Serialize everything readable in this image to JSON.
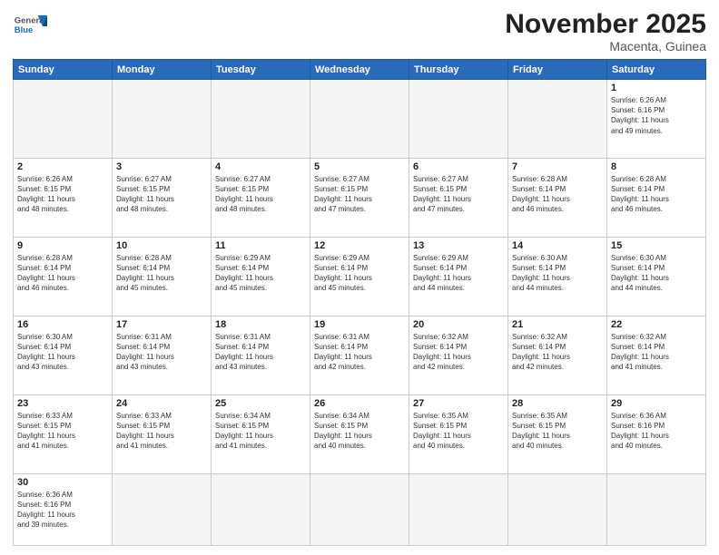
{
  "header": {
    "logo_general": "General",
    "logo_blue": "Blue",
    "main_title": "November 2025",
    "subtitle": "Macenta, Guinea"
  },
  "days_of_week": [
    "Sunday",
    "Monday",
    "Tuesday",
    "Wednesday",
    "Thursday",
    "Friday",
    "Saturday"
  ],
  "weeks": [
    [
      {
        "day": "",
        "info": ""
      },
      {
        "day": "",
        "info": ""
      },
      {
        "day": "",
        "info": ""
      },
      {
        "day": "",
        "info": ""
      },
      {
        "day": "",
        "info": ""
      },
      {
        "day": "",
        "info": ""
      },
      {
        "day": "1",
        "info": "Sunrise: 6:26 AM\nSunset: 6:16 PM\nDaylight: 11 hours\nand 49 minutes."
      }
    ],
    [
      {
        "day": "2",
        "info": "Sunrise: 6:26 AM\nSunset: 6:15 PM\nDaylight: 11 hours\nand 48 minutes."
      },
      {
        "day": "3",
        "info": "Sunrise: 6:27 AM\nSunset: 6:15 PM\nDaylight: 11 hours\nand 48 minutes."
      },
      {
        "day": "4",
        "info": "Sunrise: 6:27 AM\nSunset: 6:15 PM\nDaylight: 11 hours\nand 48 minutes."
      },
      {
        "day": "5",
        "info": "Sunrise: 6:27 AM\nSunset: 6:15 PM\nDaylight: 11 hours\nand 47 minutes."
      },
      {
        "day": "6",
        "info": "Sunrise: 6:27 AM\nSunset: 6:15 PM\nDaylight: 11 hours\nand 47 minutes."
      },
      {
        "day": "7",
        "info": "Sunrise: 6:28 AM\nSunset: 6:14 PM\nDaylight: 11 hours\nand 46 minutes."
      },
      {
        "day": "8",
        "info": "Sunrise: 6:28 AM\nSunset: 6:14 PM\nDaylight: 11 hours\nand 46 minutes."
      }
    ],
    [
      {
        "day": "9",
        "info": "Sunrise: 6:28 AM\nSunset: 6:14 PM\nDaylight: 11 hours\nand 46 minutes."
      },
      {
        "day": "10",
        "info": "Sunrise: 6:28 AM\nSunset: 6:14 PM\nDaylight: 11 hours\nand 45 minutes."
      },
      {
        "day": "11",
        "info": "Sunrise: 6:29 AM\nSunset: 6:14 PM\nDaylight: 11 hours\nand 45 minutes."
      },
      {
        "day": "12",
        "info": "Sunrise: 6:29 AM\nSunset: 6:14 PM\nDaylight: 11 hours\nand 45 minutes."
      },
      {
        "day": "13",
        "info": "Sunrise: 6:29 AM\nSunset: 6:14 PM\nDaylight: 11 hours\nand 44 minutes."
      },
      {
        "day": "14",
        "info": "Sunrise: 6:30 AM\nSunset: 6:14 PM\nDaylight: 11 hours\nand 44 minutes."
      },
      {
        "day": "15",
        "info": "Sunrise: 6:30 AM\nSunset: 6:14 PM\nDaylight: 11 hours\nand 44 minutes."
      }
    ],
    [
      {
        "day": "16",
        "info": "Sunrise: 6:30 AM\nSunset: 6:14 PM\nDaylight: 11 hours\nand 43 minutes."
      },
      {
        "day": "17",
        "info": "Sunrise: 6:31 AM\nSunset: 6:14 PM\nDaylight: 11 hours\nand 43 minutes."
      },
      {
        "day": "18",
        "info": "Sunrise: 6:31 AM\nSunset: 6:14 PM\nDaylight: 11 hours\nand 43 minutes."
      },
      {
        "day": "19",
        "info": "Sunrise: 6:31 AM\nSunset: 6:14 PM\nDaylight: 11 hours\nand 42 minutes."
      },
      {
        "day": "20",
        "info": "Sunrise: 6:32 AM\nSunset: 6:14 PM\nDaylight: 11 hours\nand 42 minutes."
      },
      {
        "day": "21",
        "info": "Sunrise: 6:32 AM\nSunset: 6:14 PM\nDaylight: 11 hours\nand 42 minutes."
      },
      {
        "day": "22",
        "info": "Sunrise: 6:32 AM\nSunset: 6:14 PM\nDaylight: 11 hours\nand 41 minutes."
      }
    ],
    [
      {
        "day": "23",
        "info": "Sunrise: 6:33 AM\nSunset: 6:15 PM\nDaylight: 11 hours\nand 41 minutes."
      },
      {
        "day": "24",
        "info": "Sunrise: 6:33 AM\nSunset: 6:15 PM\nDaylight: 11 hours\nand 41 minutes."
      },
      {
        "day": "25",
        "info": "Sunrise: 6:34 AM\nSunset: 6:15 PM\nDaylight: 11 hours\nand 41 minutes."
      },
      {
        "day": "26",
        "info": "Sunrise: 6:34 AM\nSunset: 6:15 PM\nDaylight: 11 hours\nand 40 minutes."
      },
      {
        "day": "27",
        "info": "Sunrise: 6:35 AM\nSunset: 6:15 PM\nDaylight: 11 hours\nand 40 minutes."
      },
      {
        "day": "28",
        "info": "Sunrise: 6:35 AM\nSunset: 6:15 PM\nDaylight: 11 hours\nand 40 minutes."
      },
      {
        "day": "29",
        "info": "Sunrise: 6:36 AM\nSunset: 6:16 PM\nDaylight: 11 hours\nand 40 minutes."
      }
    ],
    [
      {
        "day": "30",
        "info": "Sunrise: 6:36 AM\nSunset: 6:16 PM\nDaylight: 11 hours\nand 39 minutes."
      },
      {
        "day": "",
        "info": ""
      },
      {
        "day": "",
        "info": ""
      },
      {
        "day": "",
        "info": ""
      },
      {
        "day": "",
        "info": ""
      },
      {
        "day": "",
        "info": ""
      },
      {
        "day": "",
        "info": ""
      }
    ]
  ]
}
